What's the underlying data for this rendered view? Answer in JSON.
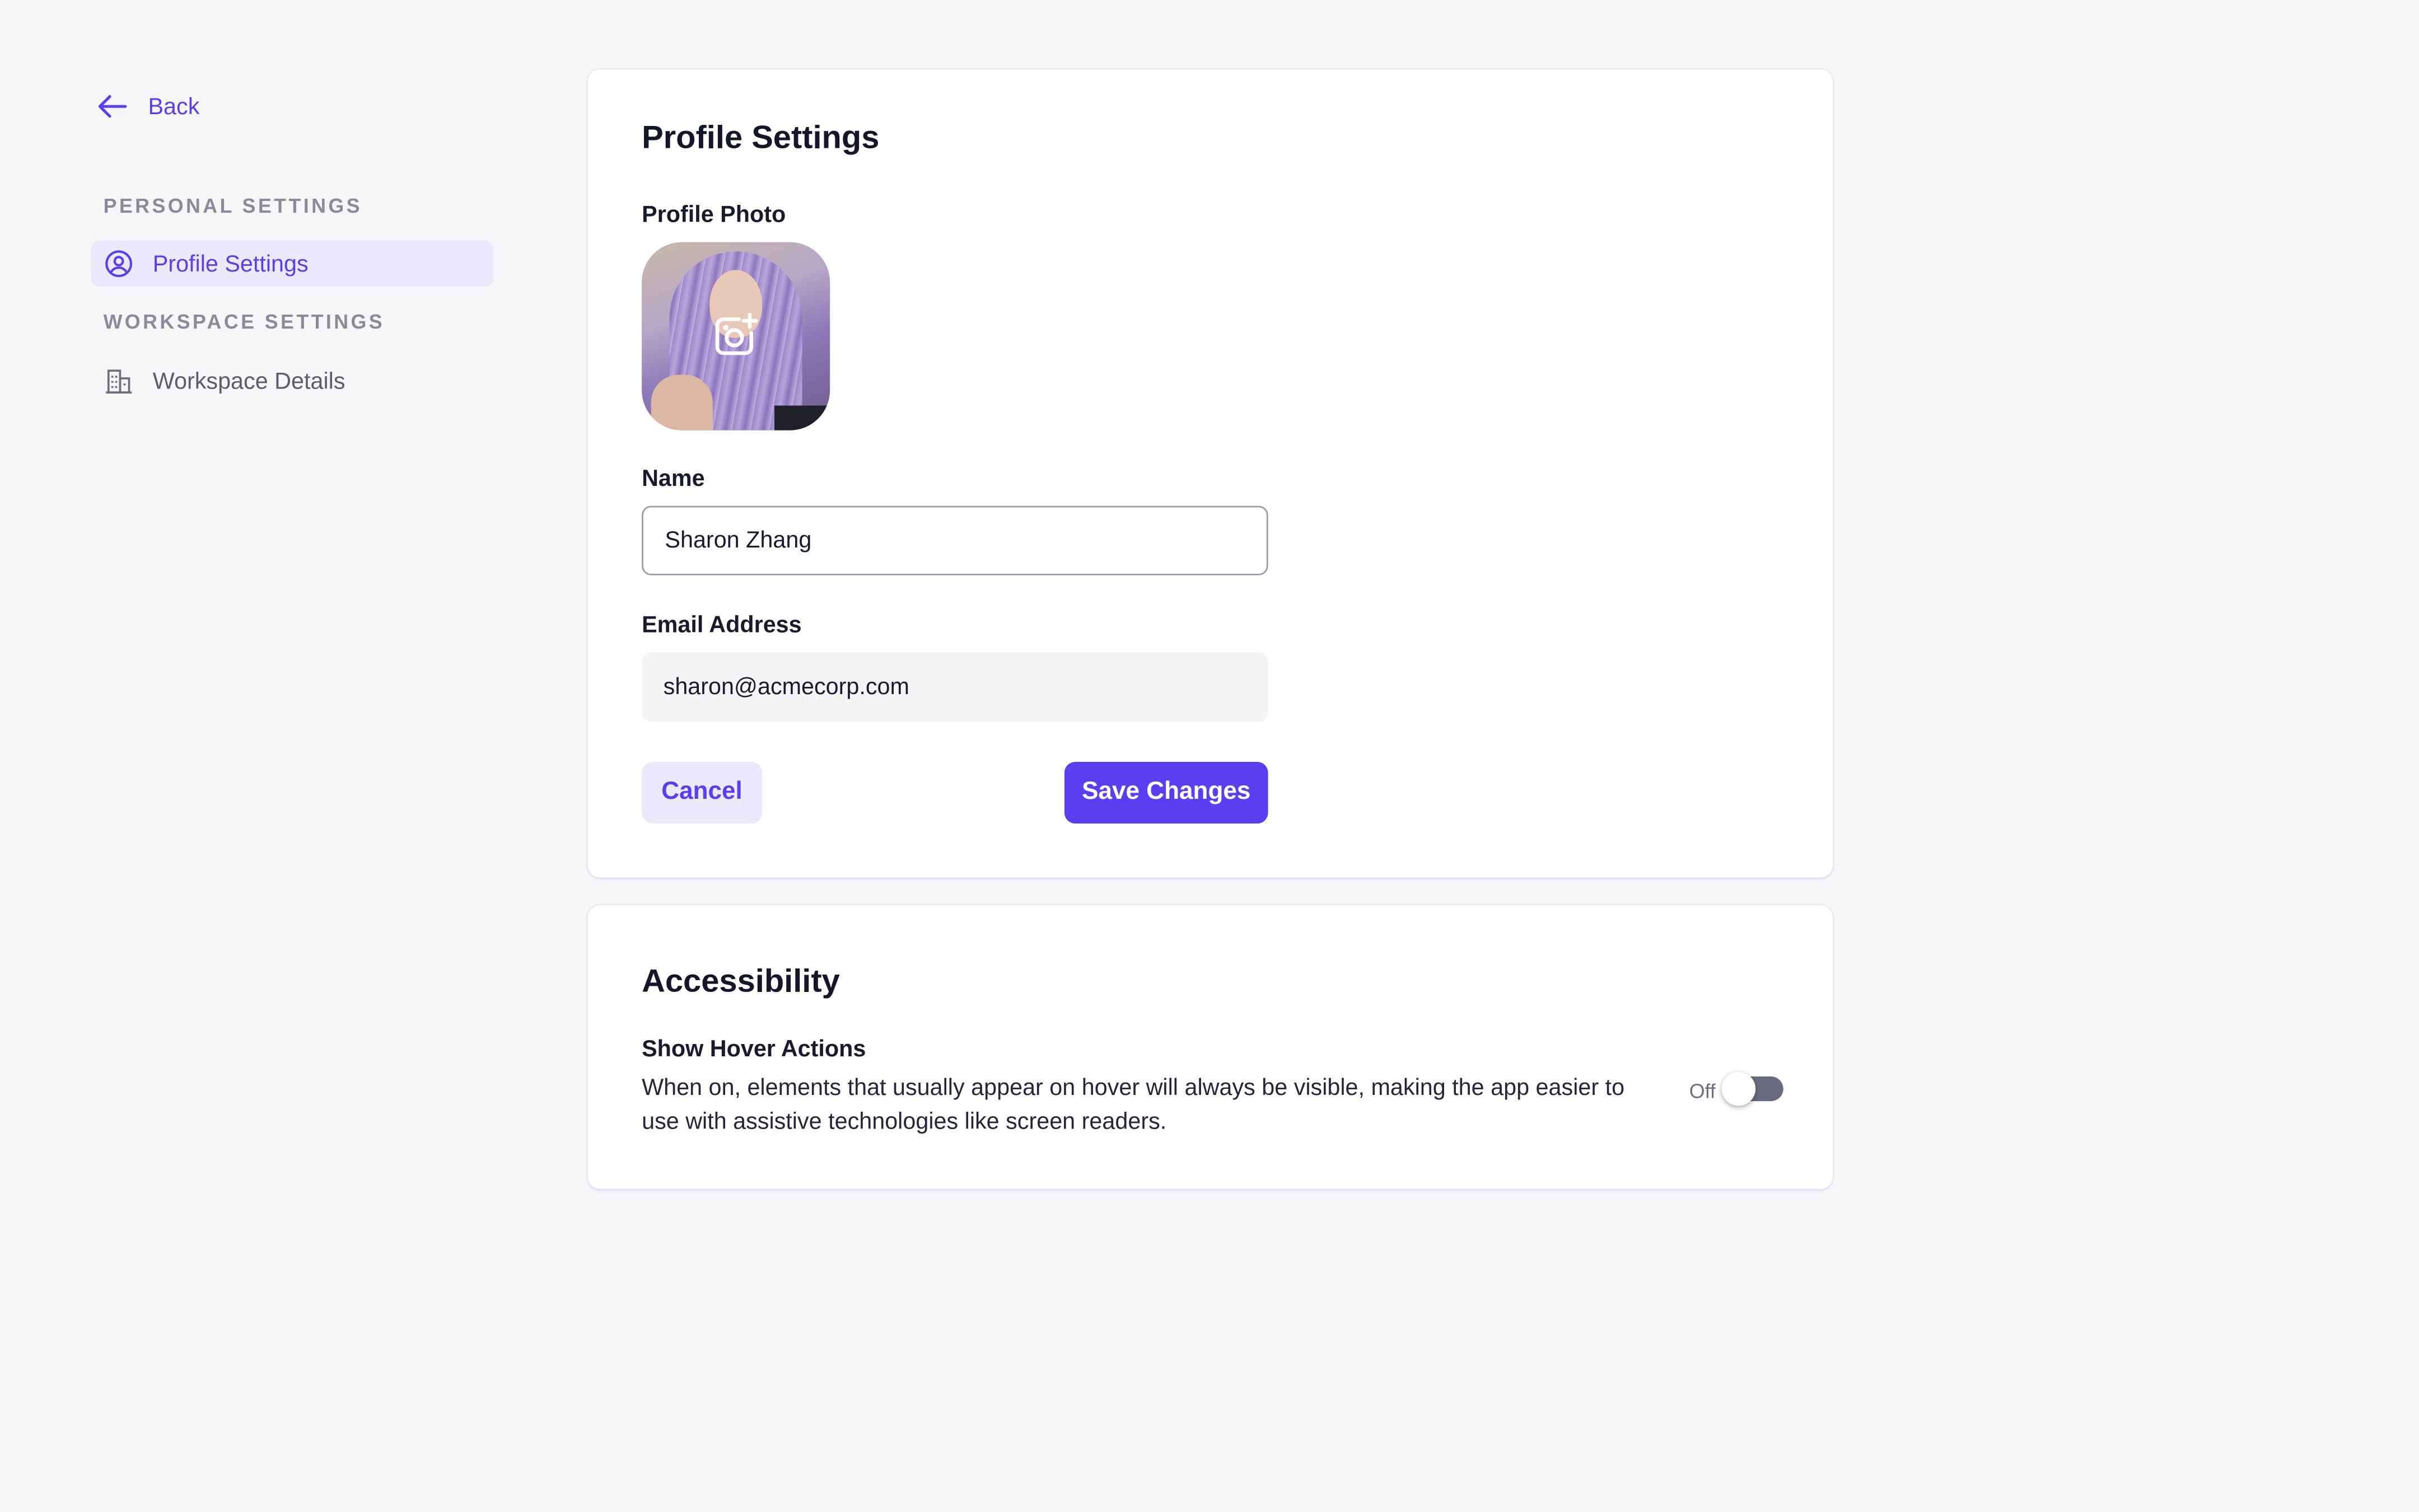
{
  "sidebar": {
    "back_label": "Back",
    "personal_heading": "PERSONAL SETTINGS",
    "workspace_heading": "WORKSPACE SETTINGS",
    "items": [
      {
        "label": "Profile Settings",
        "icon": "user-circle-icon",
        "active": true
      },
      {
        "label": "Workspace Details",
        "icon": "building-icon",
        "active": false
      }
    ]
  },
  "profile": {
    "title": "Profile Settings",
    "photo_label": "Profile Photo",
    "photo_overlay_icon": "camera-plus-icon",
    "name_label": "Name",
    "name_value": "Sharon Zhang",
    "email_label": "Email Address",
    "email_value": "sharon@acmecorp.com",
    "cancel_label": "Cancel",
    "save_label": "Save Changes"
  },
  "accessibility": {
    "title": "Accessibility",
    "setting_label": "Show Hover Actions",
    "description": "When on, elements that usually appear on hover will always be visible, making the app easier to use with assistive technologies like screen readers.",
    "toggle_state_label": "Off",
    "toggle_on": false
  },
  "colors": {
    "accent": "#5a3ff0",
    "accent_soft": "#ece8fd",
    "background": "#f6f6f8",
    "card": "#ffffff"
  }
}
